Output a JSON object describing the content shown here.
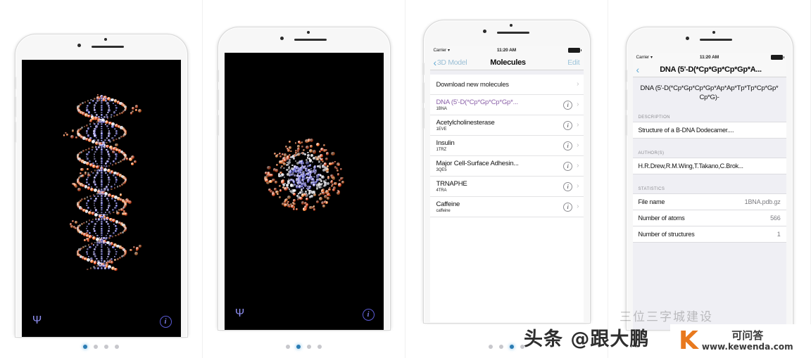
{
  "gallery": {
    "panel_count": 4,
    "accent_dot_color": "#2b7cb3",
    "inactive_dot_color": "#c7c7cc"
  },
  "status_bar": {
    "carrier": "Carrier",
    "wifi_icon": "wifi-icon",
    "time": "11:20 AM",
    "battery_icon": "battery-full-icon"
  },
  "panel1": {
    "name": "dna-side-view",
    "toolbar": {
      "left_icon": "molecule-style-icon",
      "left_glyph": "Ψ",
      "right_icon": "info-icon",
      "right_glyph": "i"
    }
  },
  "panel2": {
    "name": "dna-end-on-view",
    "toolbar": {
      "left_icon": "molecule-style-icon",
      "left_glyph": "Ψ",
      "right_icon": "info-icon",
      "right_glyph": "i"
    }
  },
  "panel3": {
    "nav": {
      "back_label": "3D Model",
      "back_icon": "chevron-left-icon",
      "title": "Molecules",
      "right_label": "Edit"
    },
    "download_row": {
      "label": "Download new molecules",
      "chevron": "›"
    },
    "molecules": [
      {
        "title": "DNA (5'-D(*Cp*Gp*Cp*Gp*...",
        "code": "1BNA",
        "highlighted": true,
        "info_glyph": "i",
        "chevron": "›"
      },
      {
        "title": "Acetylcholinesterase",
        "code": "1EVE",
        "highlighted": false,
        "info_glyph": "i",
        "chevron": "›"
      },
      {
        "title": "Insulin",
        "code": "1TRZ",
        "highlighted": false,
        "info_glyph": "i",
        "chevron": "›"
      },
      {
        "title": "Major Cell-Surface Adhesin...",
        "code": "3QE5",
        "highlighted": false,
        "info_glyph": "i",
        "chevron": "›"
      },
      {
        "title": "TRNAPHE",
        "code": "4TRA",
        "highlighted": false,
        "info_glyph": "i",
        "chevron": "›"
      },
      {
        "title": "Caffeine",
        "code": "caffeine",
        "highlighted": false,
        "info_glyph": "i",
        "chevron": "›"
      }
    ]
  },
  "panel4": {
    "nav": {
      "back_icon": "chevron-left-icon",
      "title": "DNA (5'-D(*Cp*Gp*Cp*Gp*A..."
    },
    "hero_title": "DNA (5'-D(*Cp*Gp*Cp*Gp*Ap*Ap*Tp*Tp*Cp*Gp*Cp*G)-",
    "sections": [
      {
        "header": "DESCRIPTION",
        "rows": [
          {
            "label": "Structure of a B-DNA Dodecamer....",
            "value": "",
            "full": true
          }
        ]
      },
      {
        "header": "AUTHOR(S)",
        "rows": [
          {
            "label": "H.R.Drew,R.M.Wing,T.Takano,C.Brok...",
            "value": "",
            "full": true
          }
        ]
      },
      {
        "header": "STATISTICS",
        "rows": [
          {
            "label": "File name",
            "value": "1BNA.pdb.gz",
            "full": false
          },
          {
            "label": "Number of atoms",
            "value": "566",
            "full": false
          },
          {
            "label": "Number of structures",
            "value": "1",
            "full": false
          }
        ]
      }
    ]
  },
  "watermark": {
    "headline": "头条 @跟大鹏",
    "ghost": "三位三字城建设",
    "logo_letter": "K",
    "logo_cn": "可问答",
    "logo_url": "www.kewenda.com"
  }
}
